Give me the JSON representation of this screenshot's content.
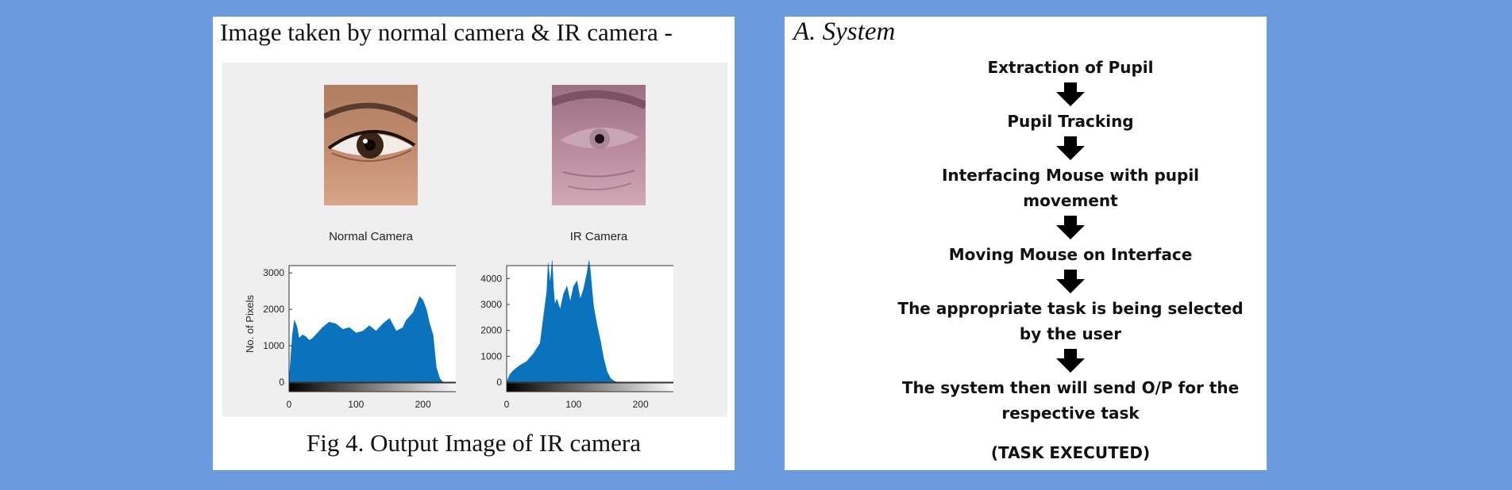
{
  "left": {
    "heading": "Image taken by normal camera & IR camera -",
    "cameras": [
      {
        "label": "Normal Camera"
      },
      {
        "label": "IR Camera"
      }
    ],
    "caption": "Fig 4. Output Image of IR camera"
  },
  "right": {
    "heading": "A.   System",
    "steps": [
      [
        "Extraction of Pupil"
      ],
      [
        "Pupil Tracking"
      ],
      [
        "Interfacing Mouse with pupil",
        "movement"
      ],
      [
        "Moving Mouse on Interface"
      ],
      [
        "The appropriate task is being selected",
        "by the user"
      ],
      [
        "The system then will send O/P for the",
        "respective task"
      ]
    ],
    "final": "(TASK EXECUTED)"
  },
  "colors": {
    "background": "#6a9be0",
    "histogram_fill": "#0b72bd"
  },
  "chart_data": [
    {
      "type": "area",
      "ylabel": "No. of Pixels",
      "xlim": [
        0,
        255
      ],
      "ylim": [
        0,
        3200
      ],
      "xticks": [
        "0",
        "100",
        "200"
      ],
      "yticks": [
        "0",
        "1000",
        "2000",
        "3000"
      ],
      "x": [
        0,
        5,
        8,
        12,
        15,
        20,
        25,
        30,
        35,
        40,
        50,
        60,
        70,
        80,
        90,
        100,
        110,
        120,
        130,
        140,
        150,
        160,
        170,
        175,
        180,
        185,
        190,
        195,
        200,
        205,
        210,
        215,
        220,
        225,
        230,
        235,
        240,
        255
      ],
      "values": [
        0,
        1300,
        1700,
        1500,
        1200,
        1300,
        1250,
        1150,
        1200,
        1300,
        1500,
        1650,
        1600,
        1450,
        1500,
        1350,
        1400,
        1550,
        1400,
        1600,
        1750,
        1400,
        1500,
        1700,
        1800,
        1900,
        2100,
        2350,
        2250,
        2000,
        1600,
        1300,
        400,
        100,
        0,
        0,
        0,
        0
      ]
    },
    {
      "type": "area",
      "xlim": [
        0,
        255
      ],
      "ylim": [
        0,
        4500
      ],
      "xticks": [
        "0",
        "100",
        "200"
      ],
      "yticks": [
        "0",
        "1000",
        "2000",
        "3000",
        "4000"
      ],
      "x": [
        0,
        5,
        10,
        15,
        20,
        30,
        40,
        50,
        55,
        60,
        62,
        65,
        68,
        70,
        72,
        75,
        80,
        85,
        90,
        95,
        100,
        105,
        110,
        115,
        120,
        123,
        125,
        128,
        130,
        135,
        140,
        145,
        150,
        155,
        160,
        165,
        255
      ],
      "values": [
        0,
        300,
        450,
        550,
        650,
        800,
        1100,
        1500,
        2500,
        3500,
        4600,
        3800,
        4700,
        3600,
        3000,
        3200,
        2800,
        3400,
        3700,
        3100,
        3700,
        3900,
        3200,
        3600,
        4200,
        4700,
        4300,
        3400,
        2900,
        2200,
        1600,
        900,
        400,
        150,
        50,
        0,
        0
      ]
    }
  ]
}
